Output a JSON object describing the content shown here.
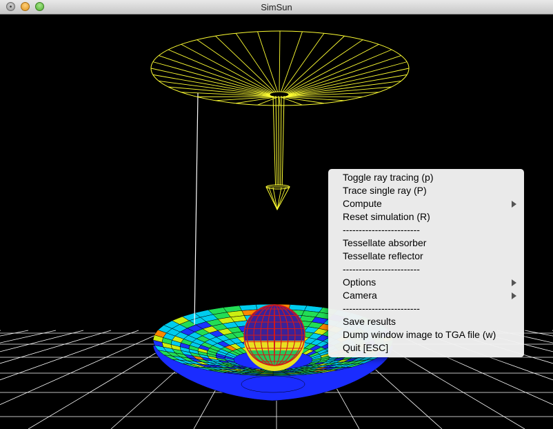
{
  "window": {
    "title": "SimSun"
  },
  "context_menu": {
    "items": [
      {
        "label": "Toggle ray tracing (p)",
        "submenu": false,
        "separator": false
      },
      {
        "label": "Trace single ray (P)",
        "submenu": false,
        "separator": false
      },
      {
        "label": "Compute",
        "submenu": true,
        "separator": false
      },
      {
        "label": "Reset simulation (R)",
        "submenu": false,
        "separator": false
      },
      {
        "label": "------------------------",
        "submenu": false,
        "separator": true
      },
      {
        "label": "Tessellate absorber",
        "submenu": false,
        "separator": false
      },
      {
        "label": "Tessellate reflector",
        "submenu": false,
        "separator": false
      },
      {
        "label": "------------------------",
        "submenu": false,
        "separator": true
      },
      {
        "label": "Options",
        "submenu": true,
        "separator": false
      },
      {
        "label": "Camera",
        "submenu": true,
        "separator": false
      },
      {
        "label": "------------------------",
        "submenu": false,
        "separator": true
      },
      {
        "label": "Save results",
        "submenu": false,
        "separator": false
      },
      {
        "label": "Dump window image to TGA file (w)",
        "submenu": false,
        "separator": false
      },
      {
        "label": "Quit [ESC]",
        "submenu": false,
        "separator": false
      }
    ]
  },
  "scene": {
    "background": "#000000",
    "sun_disk_color": "#ffff33",
    "ray_color": "#ffffff",
    "grid_color": "#ffffff",
    "absorber_color": "#cc1111",
    "reflector_palette": [
      "#1a33ff",
      "#00ccee",
      "#22dd55",
      "#ccee11",
      "#ff8800"
    ]
  }
}
